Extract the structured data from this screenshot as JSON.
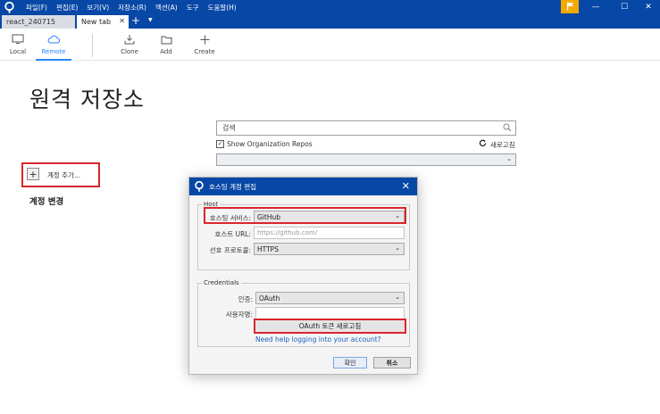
{
  "menu": [
    "파일(F)",
    "편집(E)",
    "보기(V)",
    "저장소(R)",
    "액션(A)",
    "도구",
    "도움말(H)"
  ],
  "window_controls": {
    "minimize": "—",
    "maximize": "☐",
    "close": "✕"
  },
  "tabs": [
    {
      "label": "react_240715"
    },
    {
      "label": "New tab",
      "close": "✕"
    }
  ],
  "tab_add": "+",
  "tab_more": "▼",
  "toolbar": {
    "local": "Local",
    "remote": "Remote",
    "clone": "Clone",
    "add": "Add",
    "create": "Create"
  },
  "page": {
    "title": "원격 저장소",
    "search_placeholder": "검색",
    "show_org_repos": "Show Organization Repos",
    "show_org_repos_checked": true,
    "refresh": "새로고침",
    "add_account": "계정 추가...",
    "add_account_icon": "+",
    "change_account": "계정 변경"
  },
  "dialog": {
    "title": "호스팅 계정 편집",
    "close": "✕",
    "host_legend": "Host",
    "hosting_service_label": "호스팅 서비스:",
    "hosting_service_value": "GitHub",
    "host_url_label": "호스트 URL:",
    "host_url_placeholder": "https://github.com/",
    "protocol_label": "선호 프로토콜:",
    "protocol_value": "HTTPS",
    "credentials_legend": "Credentials",
    "auth_label": "인증:",
    "auth_value": "OAuth",
    "username_label": "사용자명:",
    "username_value": "",
    "oauth_refresh": "OAuth 토큰 새로고침",
    "help_link": "Need help logging into your account?",
    "ok": "확인",
    "cancel": "취소"
  },
  "colors": {
    "titlebar": "#0747a6",
    "accent": "#2684ff",
    "highlight": "#d8262d",
    "flag": "#f5a800"
  }
}
